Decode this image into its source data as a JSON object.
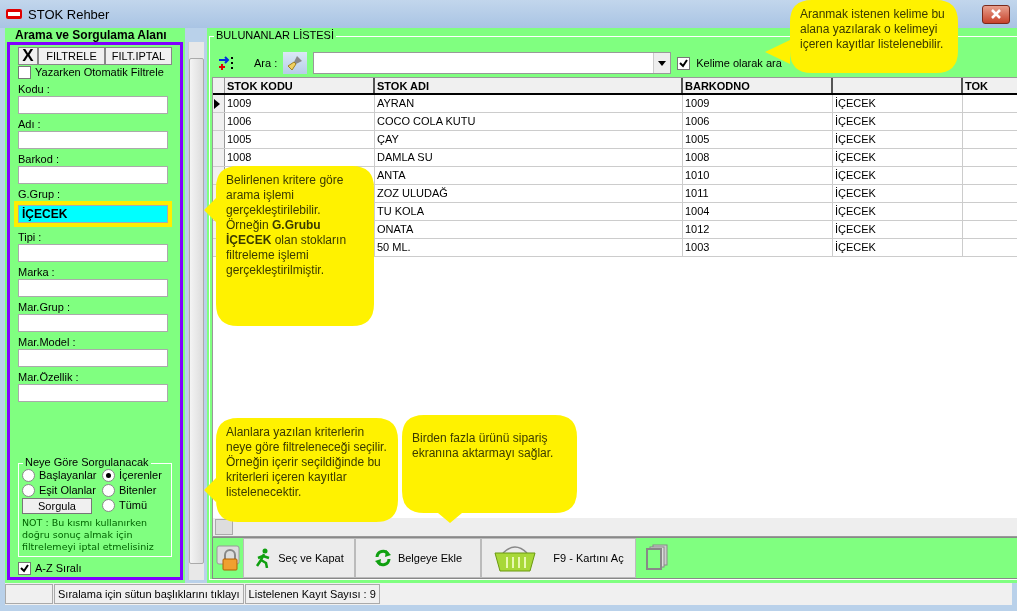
{
  "window": {
    "title": "STOK Rehber"
  },
  "search_panel": {
    "title": "Arama ve Sorgulama Alanı",
    "toolbar": [
      "X",
      "FILTRELE",
      "FILT.IPTAL"
    ],
    "auto_filter": {
      "label": "Yazarken Otomatik Filtrele",
      "checked": false
    },
    "fields": [
      {
        "label": "Kodu :",
        "highlighted": false
      },
      {
        "label": "Adı :",
        "highlighted": false
      },
      {
        "label": "Barkod :",
        "highlighted": false
      },
      {
        "label": "G.Grup :",
        "value": "İÇECEK",
        "highlighted": true
      },
      {
        "label": "Tipi :",
        "highlighted": false
      },
      {
        "label": "Marka :",
        "highlighted": false
      },
      {
        "label": "Mar.Grup :",
        "highlighted": false
      },
      {
        "label": "Mar.Model :",
        "highlighted": false
      },
      {
        "label": "Mar.Özellik :",
        "highlighted": false
      }
    ],
    "match_group": {
      "title": "Neye Göre Sorgulanacak",
      "options": [
        {
          "label": "Başlayanlar",
          "selected": false
        },
        {
          "label": "İçerenler",
          "selected": true
        },
        {
          "label": "Eşit Olanlar",
          "selected": false
        },
        {
          "label": "Bitenler",
          "selected": false
        },
        {
          "label": "Tümü",
          "selected": false
        }
      ],
      "button": "Sorgula",
      "note": "NOT : Bu kısmı kullanırken doğru sonuç almak için filtrelemeyi iptal etmelisiniz"
    },
    "sort_az": {
      "label": "A-Z Sıralı",
      "checked": true
    }
  },
  "results": {
    "title": "BULUNANLAR LİSTESİ",
    "search_label": "Ara :",
    "whole_word": {
      "label": "Kelime olarak ara",
      "checked": true
    },
    "table": {
      "columns": [
        "STOK KODU",
        "STOK ADI",
        "BARKODNO"
      ],
      "column_5_header": "TOK",
      "rows": [
        {
          "code": "1009",
          "name": "AYRAN",
          "barcode": "1009",
          "column_4": "İÇECEK",
          "selected": true
        },
        {
          "code": "1006",
          "name": "COCO COLA KUTU",
          "barcode": "1006",
          "column_4": "İÇECEK",
          "selected": false
        },
        {
          "code": "1005",
          "name": "ÇAY",
          "barcode": "1005",
          "column_4": "İÇECEK",
          "selected": false
        },
        {
          "code": "1008",
          "name": "DAMLA SU",
          "barcode": "1008",
          "column_4": "İÇECEK",
          "selected": false
        },
        {
          "name": "ANTA",
          "barcode": "1010",
          "column_4": "İÇECEK"
        },
        {
          "name": "ZOZ ULUDAĞ",
          "barcode": "1011",
          "column_4": "İÇECEK"
        },
        {
          "name": "TU KOLA",
          "barcode": "1004",
          "column_4": "İÇECEK"
        },
        {
          "name": "ONATA",
          "barcode": "1012",
          "column_4": "İÇECEK"
        },
        {
          "name": "50 ML.",
          "barcode": "1003",
          "column_4": "İÇECEK"
        }
      ]
    },
    "buttons": [
      "Seç ve Kapat",
      "Belgeye Ekle",
      "F9 - Kartını Aç"
    ]
  },
  "status_bar": [
    "Sıralama için sütun başlıklarını tıklayı",
    "Listelenen Kayıt Sayısı : 9"
  ],
  "callouts": [
    {
      "kind": "left",
      "text": "Aranmak istenen kelime bu alana yazılarak o kelimeyi içeren kayıtlar listelenebilir."
    },
    {
      "kind": "left",
      "text": "Belirlenen kritere göre arama işlemi gerçekleştirilebilir. Örneğin **G.Grubu İÇECEK** olan stokların filtreleme işlemi gerçekleştirilmiştir."
    },
    {
      "kind": "left",
      "text": "Alanlara yazılan kriterlerin neye göre filtreleneceği seçilir. Örneğin içerir seçildiğinde bu kriterleri içeren kayıtlar listelenecektir."
    },
    {
      "kind": "down",
      "text": "Birden fazla ürünü sipariş ekranına aktarmayı sağlar."
    }
  ]
}
